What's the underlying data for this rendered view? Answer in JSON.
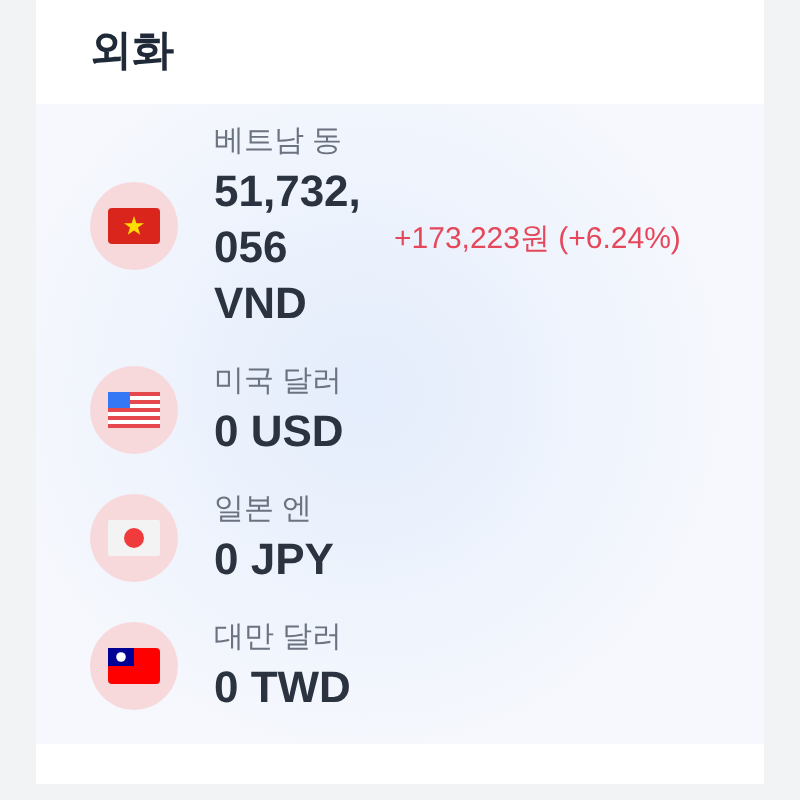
{
  "section": {
    "title": "외화"
  },
  "currencies": [
    {
      "kind": "vn",
      "name": "베트남 동",
      "amount": "51,732,056 VND",
      "change": "+173,223원 (+6.24%)"
    },
    {
      "kind": "us",
      "name": "미국 달러",
      "amount": "0 USD"
    },
    {
      "kind": "jp",
      "name": "일본 엔",
      "amount": "0 JPY"
    },
    {
      "kind": "tw",
      "name": "대만 달러",
      "amount": "0 TWD"
    }
  ]
}
